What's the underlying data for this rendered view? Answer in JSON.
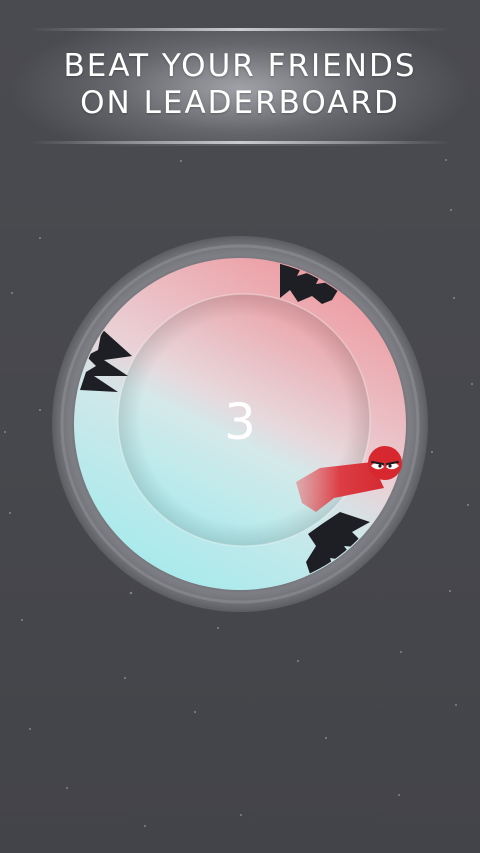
{
  "banner": {
    "line1": "BEAT YOUR FRIENDS",
    "line2": "ON LEADERBOARD"
  },
  "game": {
    "score": "3",
    "colors": {
      "background": "#48494e",
      "ring_top": "#e9a3a8",
      "ring_bottom": "#aee8ea",
      "spike": "#1e1f24",
      "snake": "#d93038"
    }
  }
}
